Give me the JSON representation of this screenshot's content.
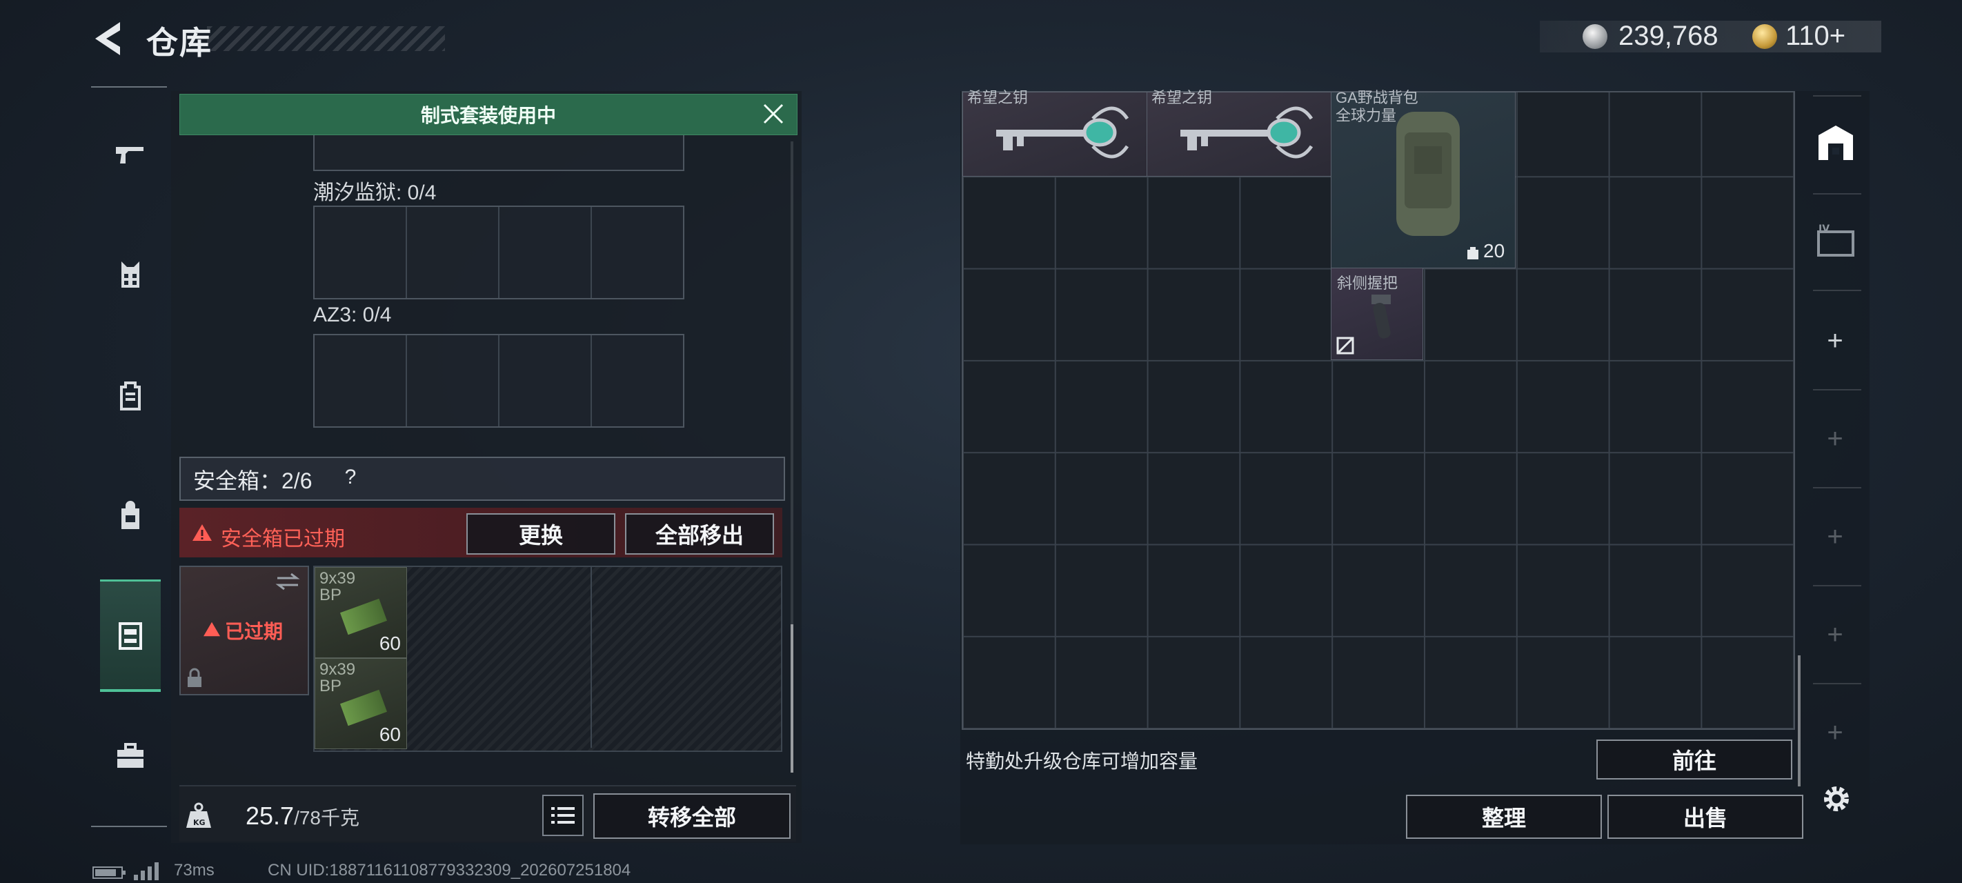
{
  "header": {
    "title": "仓库",
    "silver_amount": "239,768",
    "gold_amount": "110+"
  },
  "sidebar": {
    "items": [
      {
        "name": "firearms",
        "icon": "gun-icon"
      },
      {
        "name": "vest",
        "icon": "vest-icon"
      },
      {
        "name": "backpack",
        "icon": "backpack-icon"
      },
      {
        "name": "bag",
        "icon": "bag-icon"
      },
      {
        "name": "safe-case",
        "icon": "case-icon",
        "active": true
      },
      {
        "name": "toolbox",
        "icon": "toolbox-icon"
      }
    ]
  },
  "left_panel": {
    "banner": "制式套装使用中",
    "sets": [
      {
        "label": "潮汐监狱: 0/4"
      },
      {
        "label": "AZ3: 0/4"
      }
    ],
    "safe_box": {
      "title": "安全箱：2/6",
      "help": "?",
      "warning": "安全箱已过期",
      "replace_button": "更换",
      "remove_all_button": "全部移出",
      "expired_badge": "已过期",
      "items": [
        {
          "name": "9x39 BP",
          "count": "60"
        },
        {
          "name": "9x39 BP",
          "count": "60"
        }
      ]
    },
    "weight": {
      "current": "25.7",
      "max": "/78千克",
      "transfer_all_button": "转移全部"
    }
  },
  "stash": {
    "items": [
      {
        "name": "希望之钥"
      },
      {
        "name": "希望之钥"
      },
      {
        "name": "GA野战背包",
        "subtitle": "全球力量",
        "capacity": "20"
      },
      {
        "name": "斜侧握把"
      }
    ],
    "upgrade_hint": "特勤处升级仓库可增加容量",
    "goto_button": "前往",
    "sort_button": "整理",
    "sell_button": "出售"
  },
  "status": {
    "ping": "73ms",
    "uid": "CN UID:18871161108779332309_202607251804"
  }
}
